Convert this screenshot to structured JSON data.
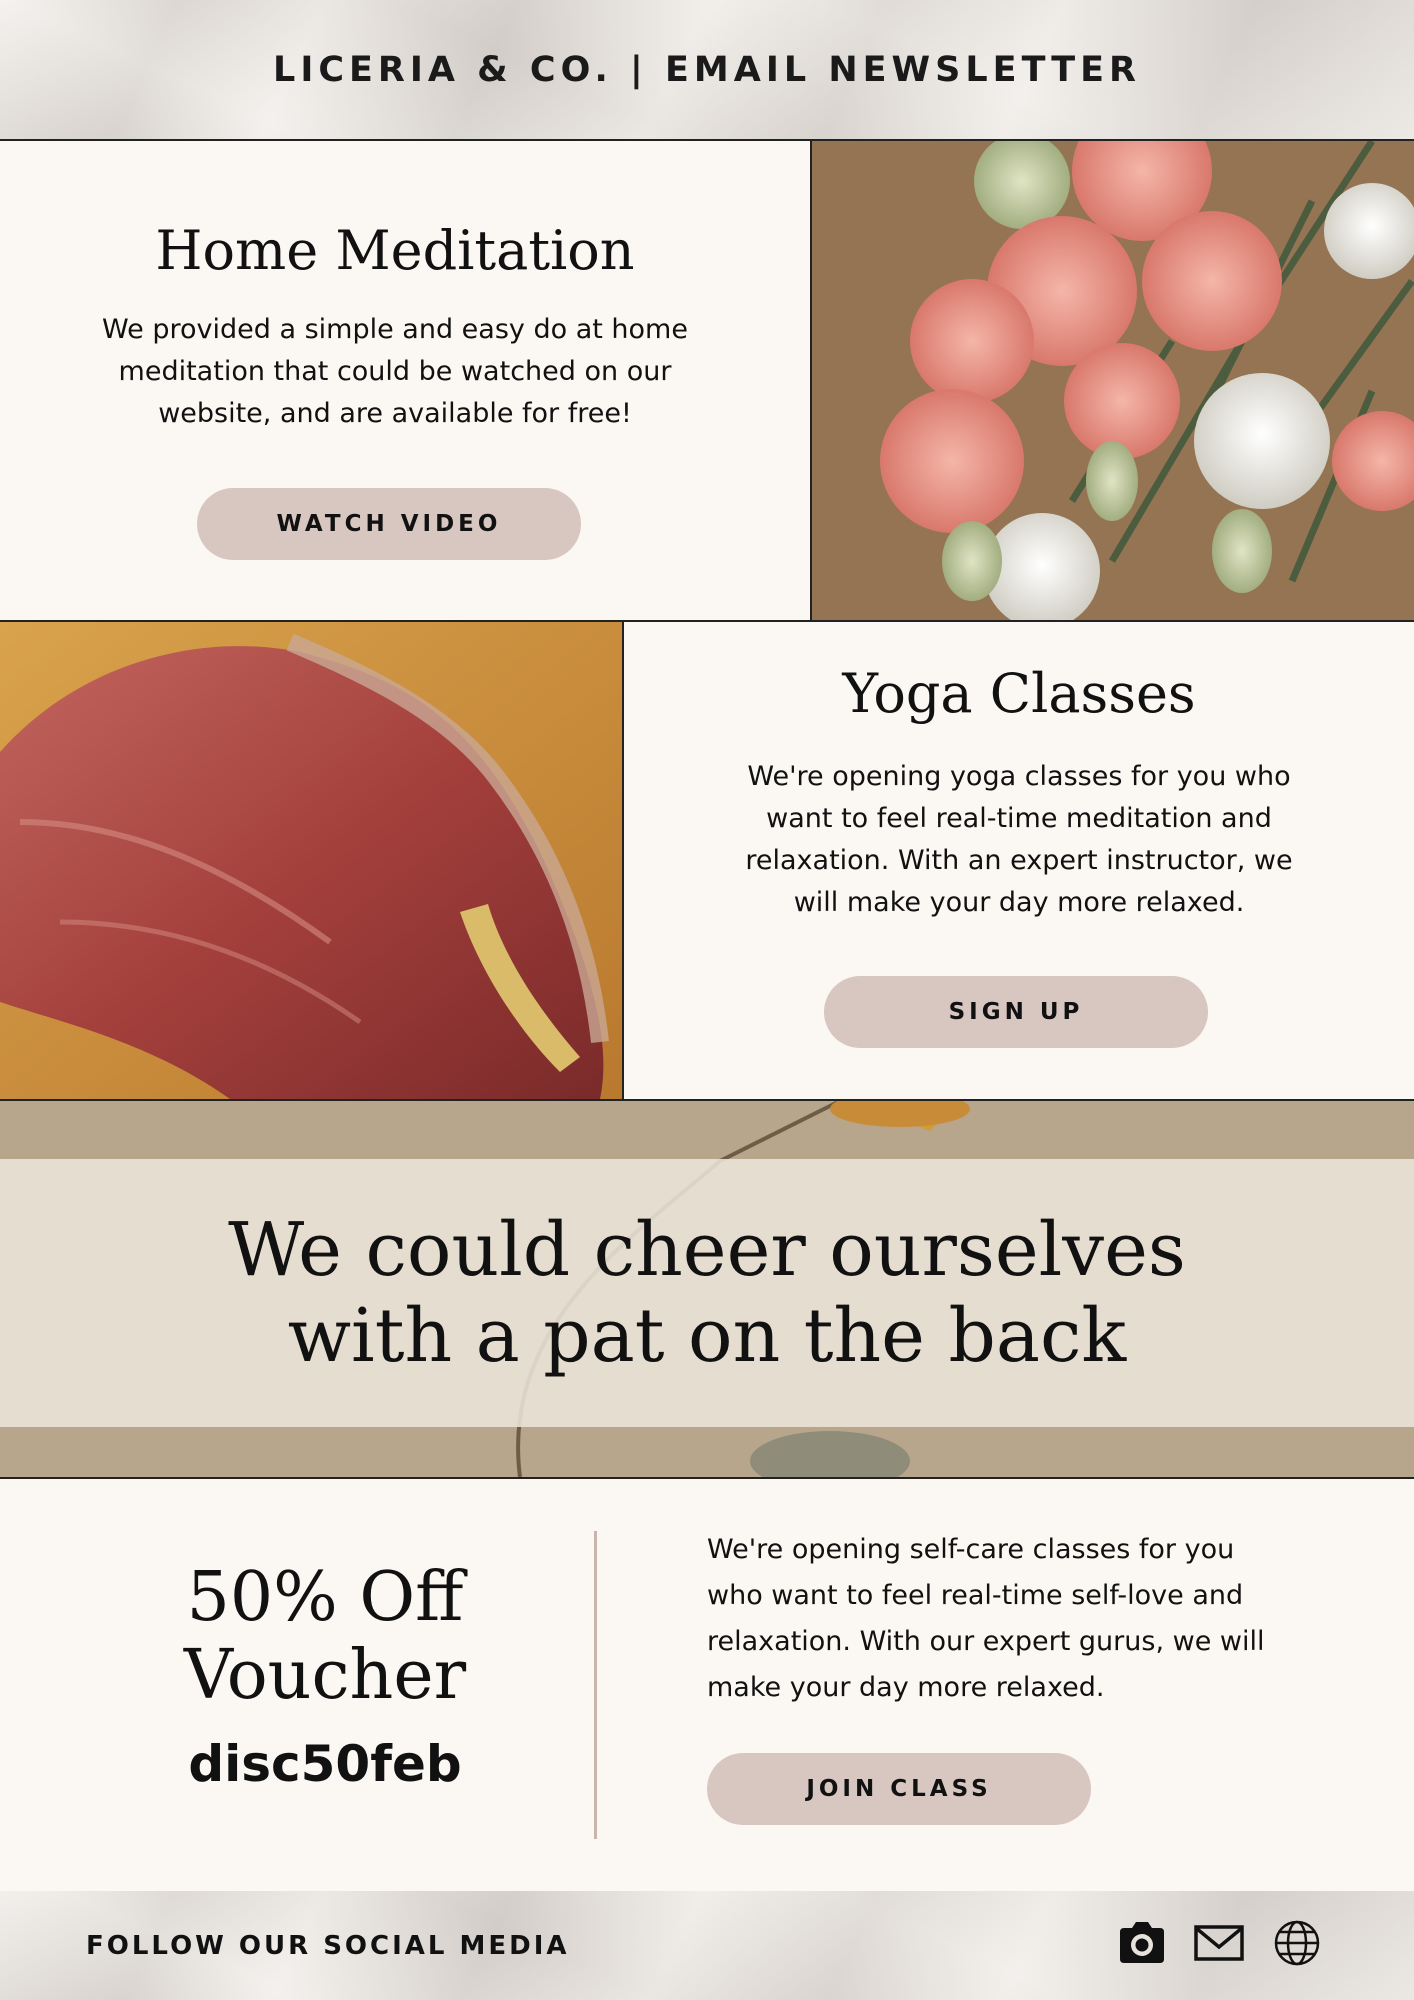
{
  "header": {
    "title": "LICERIA & CO. | EMAIL NEWSLETTER"
  },
  "meditation": {
    "title": "Home Meditation",
    "lines": [
      "We provided a simple and easy do at home",
      "meditation that could be watched on our",
      "website, and are available for free!"
    ],
    "button": "WATCH VIDEO"
  },
  "yoga": {
    "title": "Yoga Classes",
    "lines": [
      "We're opening yoga classes for you who",
      "want to feel real-time meditation and",
      "relaxation. With an expert instructor, we",
      "will make your day more relaxed."
    ],
    "button": "SIGN UP"
  },
  "quote": {
    "line1": "We could cheer ourselves",
    "line2": "with a pat on the back"
  },
  "voucher": {
    "title_line1": "50% Off",
    "title_line2": "Voucher",
    "code": "disc50feb",
    "lines": [
      "We're opening self-care classes for you",
      "who want to feel real-time self-love and",
      "relaxation. With our expert gurus, we will",
      "make your day more relaxed."
    ],
    "button": "JOIN CLASS"
  },
  "footer": {
    "label": "FOLLOW OUR SOCIAL MEDIA",
    "icons": [
      "camera-icon",
      "mail-icon",
      "globe-icon"
    ]
  },
  "colors": {
    "cream": "#fbf7f2",
    "button": "#d8c7c1",
    "text": "#111111",
    "divider": "#c9b5ad"
  }
}
